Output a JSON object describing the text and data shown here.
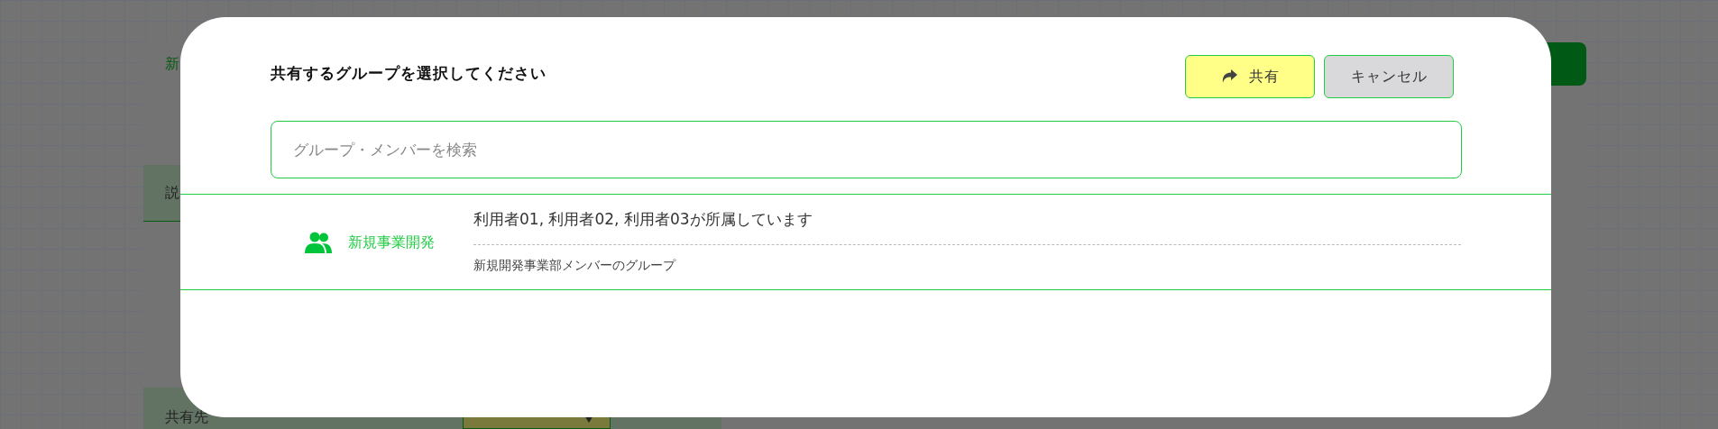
{
  "background": {
    "title_fragment": "新",
    "section_label_fragment": "説",
    "share_target_label": "共有先"
  },
  "dialog": {
    "title": "共有するグループを選択してください",
    "buttons": [
      {
        "kind": "share",
        "label": "共有"
      },
      {
        "kind": "cancel",
        "label": "キャンセル"
      }
    ],
    "search": {
      "placeholder": "グループ・メンバーを検索"
    },
    "groups": [
      {
        "name": "新規事業開発",
        "members": "利用者01, 利用者02, 利用者03が所属しています",
        "description": "新規開発事業部メンバーのグループ"
      }
    ]
  }
}
